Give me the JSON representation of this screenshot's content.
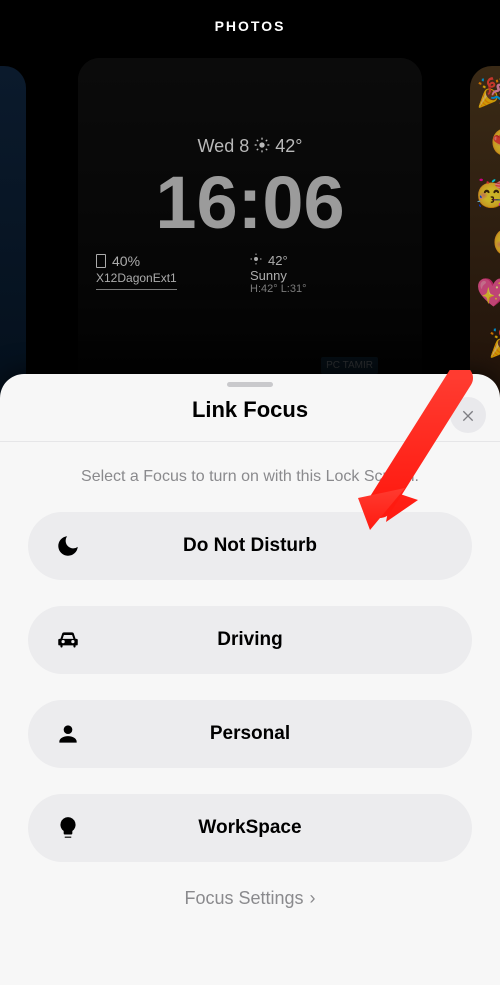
{
  "header": {
    "label": "PHOTOS"
  },
  "lockscreen": {
    "date_prefix": "Wed 8",
    "temp": "42°",
    "time": "16:06",
    "battery_pct": "40%",
    "wifi_name": "X12DagonExt1",
    "weather_temp": "42°",
    "weather_cond": "Sunny",
    "weather_hl": "H:42° L:31°",
    "city_sign": "PC TAMIR"
  },
  "sheet": {
    "title": "Link Focus",
    "subtitle": "Select a Focus to turn on with this Lock Screen.",
    "close_aria": "Close",
    "options": {
      "dnd": "Do Not Disturb",
      "driving": "Driving",
      "personal": "Personal",
      "workspace": "WorkSpace"
    },
    "footer": "Focus Settings"
  }
}
